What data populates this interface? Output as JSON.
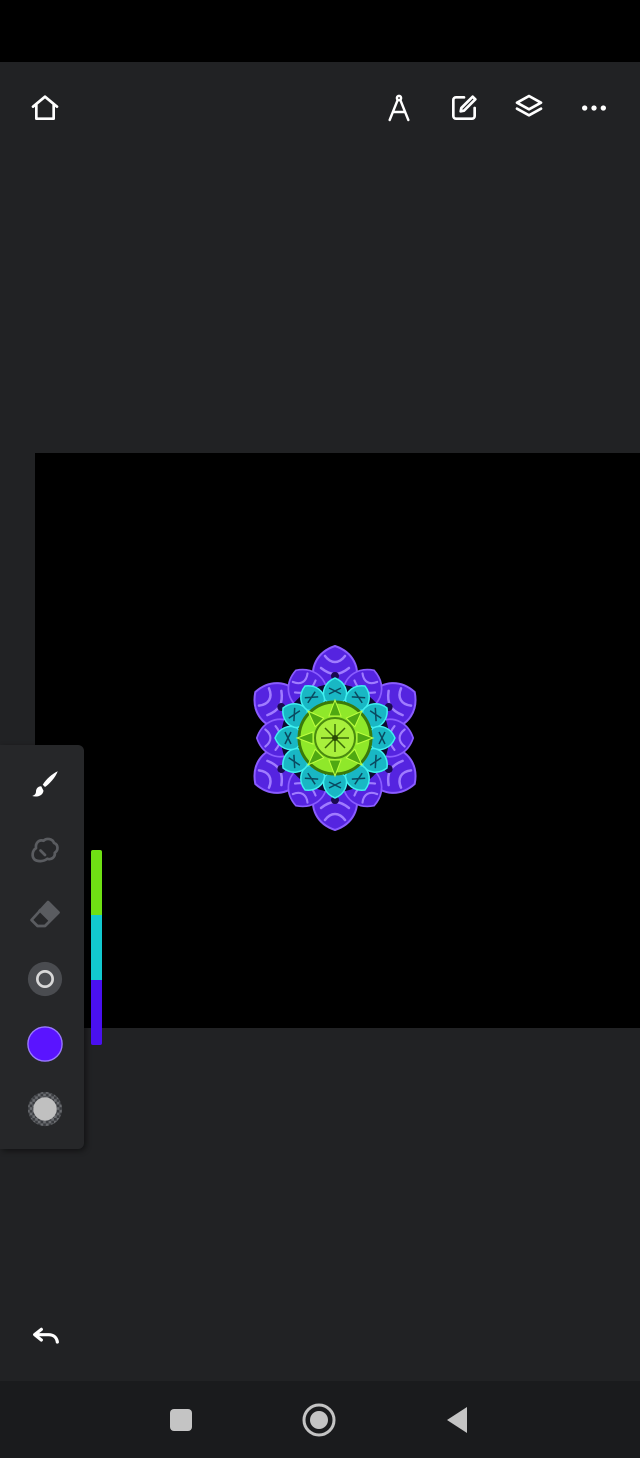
{
  "top_toolbar": {
    "left_icons": [
      "home-icon"
    ],
    "right_icons": [
      "compass-icon",
      "edit-icon",
      "layers-icon",
      "more-icon"
    ]
  },
  "tools": [
    "brush-icon",
    "smudge-icon",
    "eraser-icon",
    "brush-size-icon",
    "color-swatch-icon",
    "opacity-icon"
  ],
  "colors": {
    "background": "#212224",
    "canvas": "#000000",
    "current_color": "#5a14ff",
    "palette": [
      "#6fe014",
      "#12c9cf",
      "#4a10f0"
    ]
  },
  "bottom": {
    "undo_icon": "undo-icon"
  },
  "nav_bar": {
    "icons": [
      "recent-apps-icon",
      "home-circle-icon",
      "back-icon"
    ]
  }
}
